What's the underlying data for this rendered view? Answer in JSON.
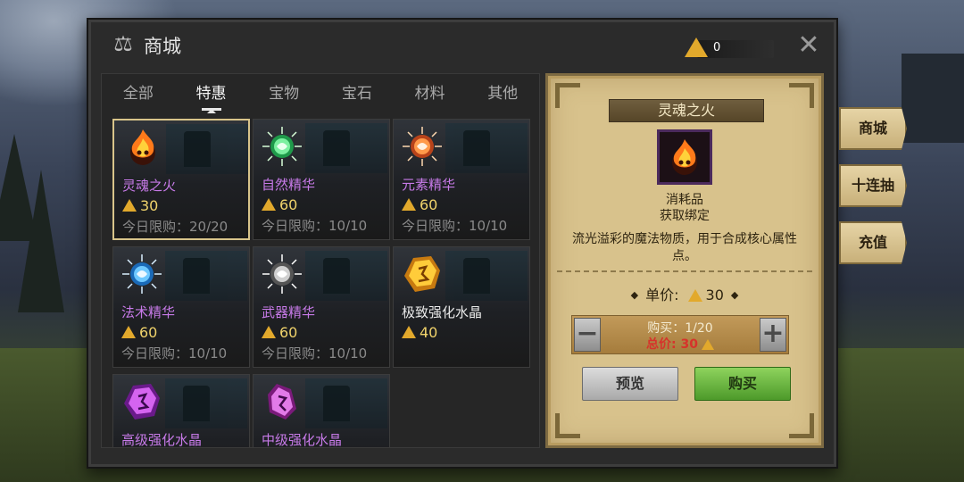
{
  "title": "商城",
  "currency": {
    "value": "0",
    "icon": "gold-triangle-icon"
  },
  "tabs": [
    {
      "label": "全部",
      "active": false
    },
    {
      "label": "特惠",
      "active": true
    },
    {
      "label": "宝物",
      "active": false
    },
    {
      "label": "宝石",
      "active": false
    },
    {
      "label": "材料",
      "active": false
    },
    {
      "label": "其他",
      "active": false
    }
  ],
  "items": [
    {
      "name": "灵魂之火",
      "price": "30",
      "limit": "今日限购：20/20",
      "color": "purple",
      "icon": "soul-fire-icon"
    },
    {
      "name": "自然精华",
      "price": "60",
      "limit": "今日限购：10/10",
      "color": "purple",
      "icon": "nature-essence-icon"
    },
    {
      "name": "元素精华",
      "price": "60",
      "limit": "今日限购：10/10",
      "color": "purple",
      "icon": "element-essence-icon"
    },
    {
      "name": "法术精华",
      "price": "60",
      "limit": "今日限购：10/10",
      "color": "purple",
      "icon": "spell-essence-icon"
    },
    {
      "name": "武器精华",
      "price": "60",
      "limit": "今日限购：10/10",
      "color": "purple",
      "icon": "weapon-essence-icon"
    },
    {
      "name": "极致强化水晶",
      "price": "40",
      "limit": "",
      "color": "white",
      "icon": "ultimate-crystal-icon"
    },
    {
      "name": "高级强化水晶",
      "price": "",
      "limit": "",
      "color": "purple",
      "icon": "advanced-crystal-icon"
    },
    {
      "name": "中级强化水晶",
      "price": "",
      "limit": "",
      "color": "purple",
      "icon": "intermediate-crystal-icon"
    }
  ],
  "detail": {
    "title": "灵魂之火",
    "type": "消耗品",
    "bind": "获取绑定",
    "description": "流光溢彩的魔法物质，用于合成核心属性点。",
    "unit_price_label": "单价:",
    "unit_price": "30",
    "purchase_count": "购买：1/20",
    "total_label": "总价:",
    "total": "30",
    "preview_label": "预览",
    "buy_label": "购买",
    "minus": "−",
    "plus": "+"
  },
  "side_tabs": [
    "商城",
    "十连抽",
    "充值"
  ],
  "colors": {
    "accent_gold": "#e2a92c",
    "rarity_purple": "#c77ae8",
    "buy_green": "#6fb844",
    "parchment": "#d8c28c"
  }
}
